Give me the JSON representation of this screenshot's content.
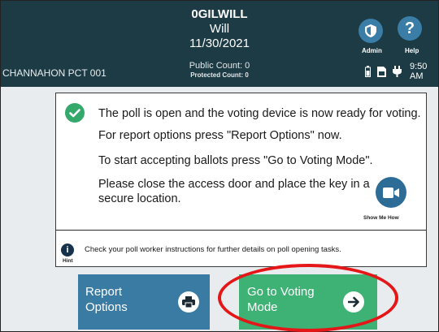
{
  "header": {
    "poll_id": "0GILWILL",
    "name": "Will",
    "date": "11/30/2021",
    "precinct": "CHANNAHON PCT 001",
    "public_count": "Public Count: 0",
    "protected_count": "Protected Count: 0",
    "admin_label": "Admin",
    "help_label": "Help",
    "clock": "9:50 AM"
  },
  "message": {
    "line1": "The poll is open and the voting device is now ready for voting.",
    "line2": "For report options press \"Report Options\" now.",
    "line3": "To start accepting ballots press \"Go to Voting Mode\".",
    "line4": "Please close the access door and place the key in a secure location.",
    "show_me_how_label": "Show Me How",
    "hint_label": "Hint",
    "hint_text": "Check your poll worker instructions for further details on poll opening tasks."
  },
  "actions": {
    "report_options": "Report Options",
    "go_to_voting_mode": "Go to Voting Mode"
  },
  "colors": {
    "header_bg": "#1d3b45",
    "accent_blue": "#3a7ba3",
    "accent_green": "#3eb174",
    "highlight_ring": "#e41617",
    "check_green": "#35a86b"
  },
  "icons": {
    "admin": "shield-icon",
    "help": "question-icon",
    "battery": "battery-icon",
    "memory": "memory-card-icon",
    "power": "power-plug-icon",
    "check": "check-circle-icon",
    "video": "video-camera-icon",
    "hint": "info-icon",
    "print": "printer-icon",
    "arrow": "arrow-right-icon"
  }
}
